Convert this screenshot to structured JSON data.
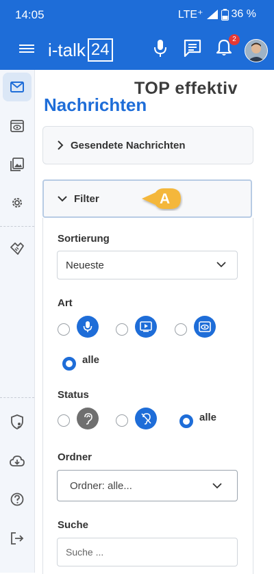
{
  "status_bar": {
    "time": "14:05",
    "network": "LTE⁺",
    "battery": "36 %"
  },
  "app_bar": {
    "logo_text": "i-talk",
    "logo_box": "24",
    "notification_count": "2"
  },
  "watermark": "TOP effektiv",
  "page_title": "Nachrichten",
  "sent_panel": {
    "label": "Gesendete Nachrichten"
  },
  "filter": {
    "label": "Filter",
    "callout": "A",
    "sortierung": {
      "label": "Sortierung",
      "value": "Neueste"
    },
    "art": {
      "label": "Art",
      "all_label": "alle"
    },
    "status": {
      "label": "Status",
      "all_label": "alle"
    },
    "ordner": {
      "label": "Ordner",
      "value": "Ordner: alle..."
    },
    "suche": {
      "label": "Suche",
      "placeholder": "Suche ..."
    }
  },
  "colors": {
    "primary": "#1e6dd8",
    "callout": "#f4b73a",
    "sidebar_bg": "#f3f6fb"
  }
}
